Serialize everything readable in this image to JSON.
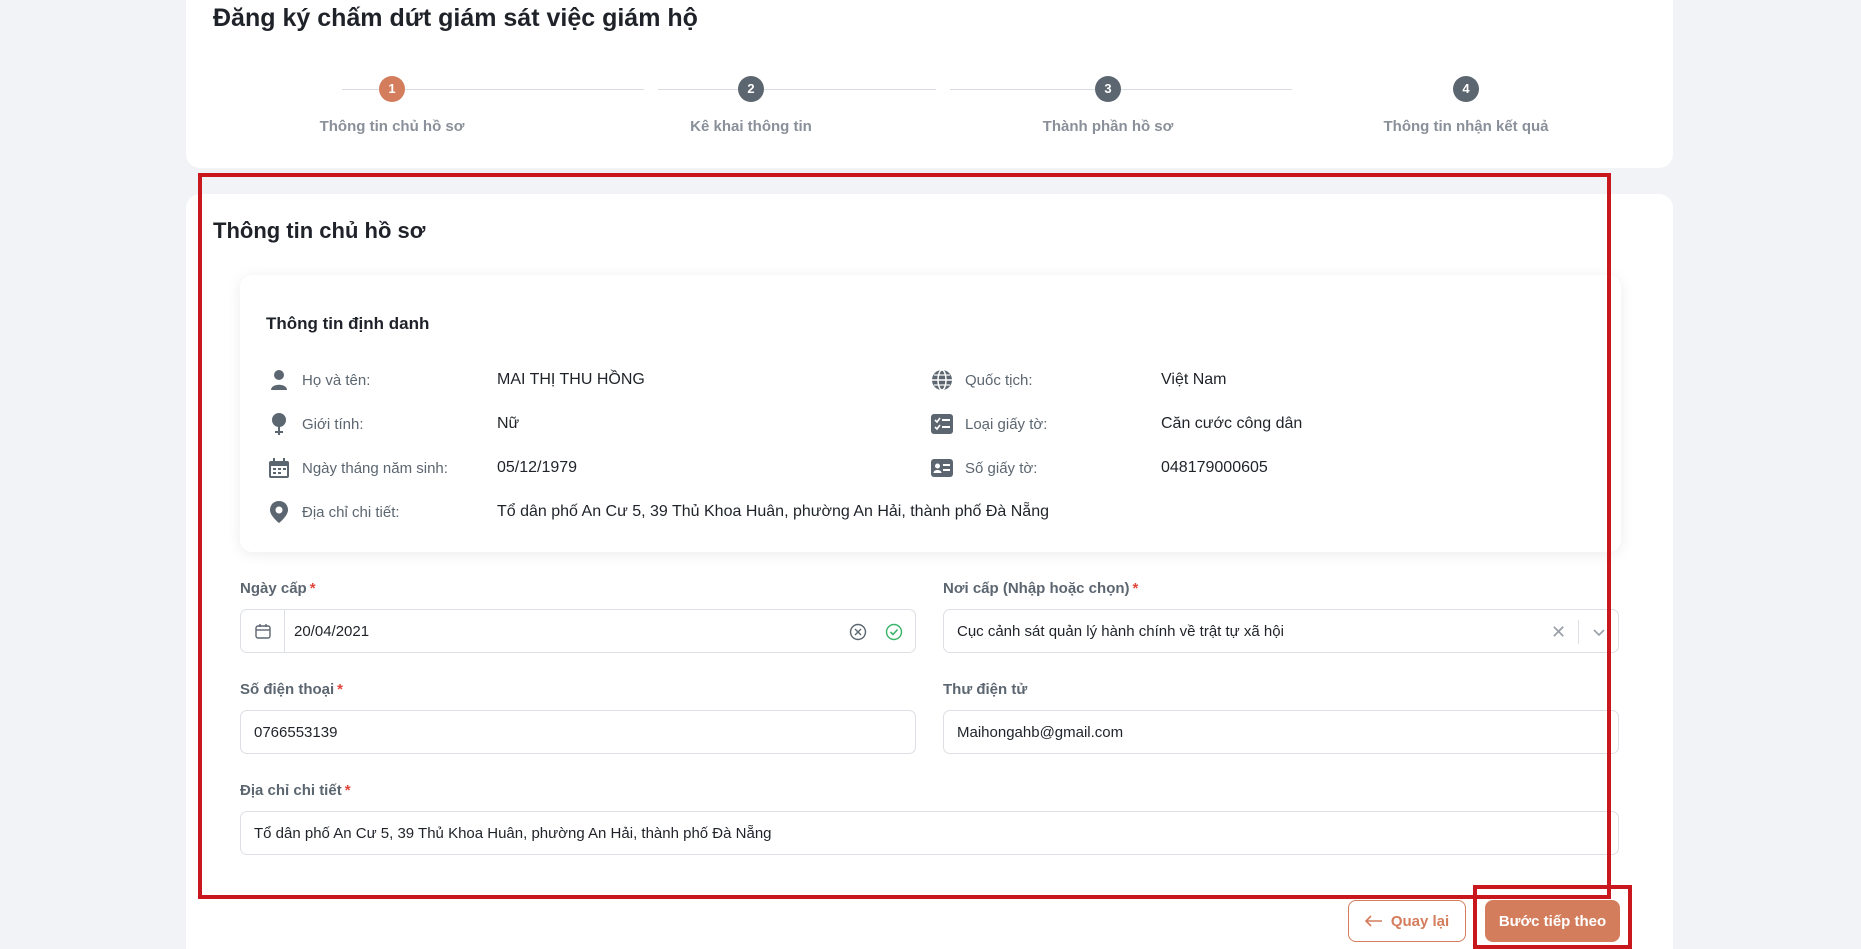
{
  "page": {
    "title": "Đăng ký chấm dứt giám sát việc giám hộ"
  },
  "stepper": {
    "steps": [
      {
        "number": "1",
        "label": "Thông tin chủ hồ sơ"
      },
      {
        "number": "2",
        "label": "Kê khai thông tin"
      },
      {
        "number": "3",
        "label": "Thành phần hồ sơ"
      },
      {
        "number": "4",
        "label": "Thông tin nhận kết quả"
      }
    ],
    "active_step": 1
  },
  "section": {
    "title": "Thông tin chủ hồ sơ"
  },
  "identity": {
    "title": "Thông tin định danh",
    "full_name": {
      "label": "Họ và tên:",
      "value": "MAI THỊ THU HỒNG",
      "icon": "user-icon"
    },
    "gender": {
      "label": "Giới tính:",
      "value": "Nữ",
      "icon": "gender-icon"
    },
    "dob": {
      "label": "Ngày tháng năm sinh:",
      "value": "05/12/1979",
      "icon": "calendar-icon"
    },
    "address": {
      "label": "Địa chỉ chi tiết:",
      "value": "Tổ dân phố An Cư 5, 39 Thủ Khoa Huân, phường An Hải, thành phố Đà Nẵng",
      "icon": "location-pin-icon"
    },
    "nationality": {
      "label": "Quốc tịch:",
      "value": "Việt Nam",
      "icon": "globe-icon"
    },
    "doc_type": {
      "label": "Loại giấy tờ:",
      "value": "Căn cước công dân",
      "icon": "checklist-icon"
    },
    "doc_number": {
      "label": "Số giấy tờ:",
      "value": "048179000605",
      "icon": "id-card-icon"
    }
  },
  "form": {
    "issue_date": {
      "label": "Ngày cấp",
      "required": "*",
      "value": "20/04/2021"
    },
    "issue_place": {
      "label": "Nơi cấp (Nhập hoặc chọn)",
      "required": "*",
      "value": "Cục cảnh sát quản lý hành chính về trật tự xã hội"
    },
    "phone": {
      "label": "Số điện thoại",
      "required": "*",
      "value": "0766553139"
    },
    "email": {
      "label": "Thư điện tử",
      "value": "Maihongahb@gmail.com"
    },
    "address": {
      "label": "Địa chỉ chi tiết",
      "required": "*",
      "value": "Tổ dân phố An Cư 5, 39 Thủ Khoa Huân, phường An Hải, thành phố Đà Nẵng"
    }
  },
  "actions": {
    "back_label": "Quay lại",
    "next_label": "Bước tiếp theo"
  },
  "colors": {
    "accent": "#d47d5c",
    "highlight_frame": "#c8181d",
    "step_inactive": "#5c6670",
    "success": "#3bb36a"
  }
}
